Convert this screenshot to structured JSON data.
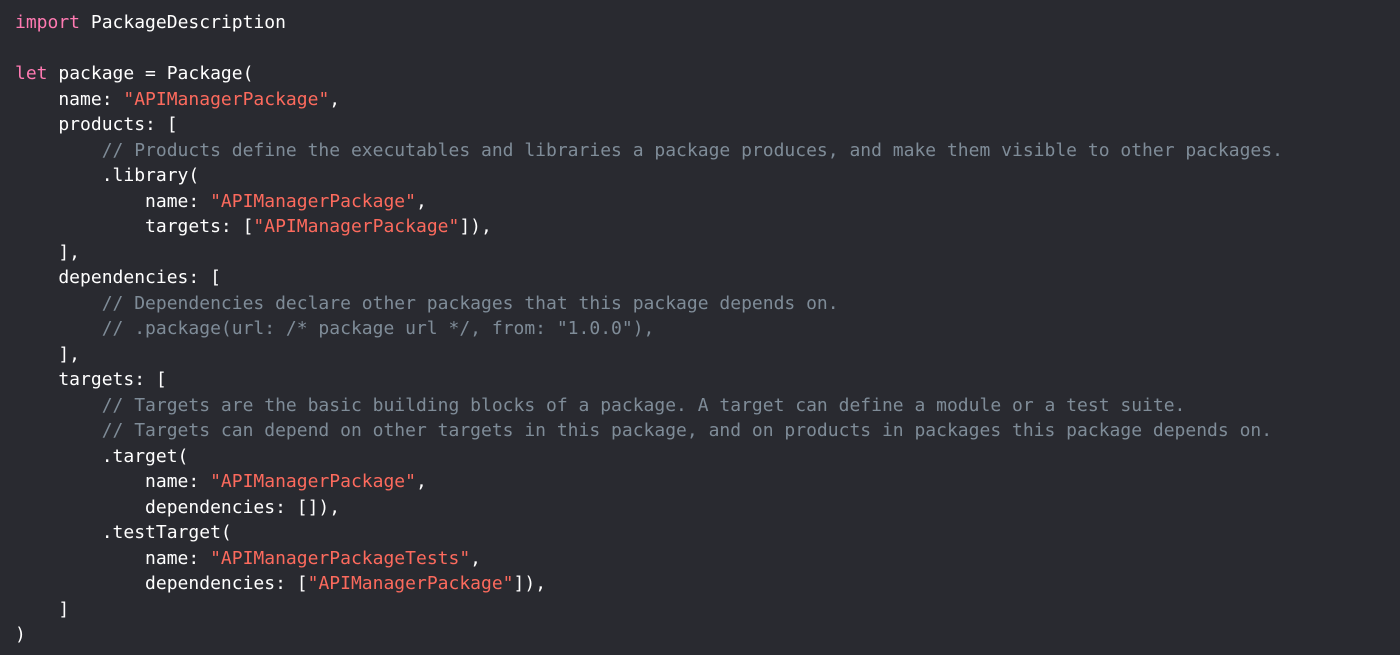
{
  "editor": {
    "language": "swift",
    "colors": {
      "background": "#292a30",
      "plain": "#ffffff",
      "keyword": "#ff7ab2",
      "string": "#fc6a5d",
      "comment": "#7f8c98"
    },
    "lines": [
      [
        {
          "t": "keyword",
          "v": "import"
        },
        {
          "t": "plain",
          "v": " PackageDescription"
        }
      ],
      [],
      [
        {
          "t": "keyword",
          "v": "let"
        },
        {
          "t": "plain",
          "v": " package = Package("
        }
      ],
      [
        {
          "t": "plain",
          "v": "    name: "
        },
        {
          "t": "string",
          "v": "\"APIManagerPackage\""
        },
        {
          "t": "plain",
          "v": ","
        }
      ],
      [
        {
          "t": "plain",
          "v": "    products: ["
        }
      ],
      [
        {
          "t": "comment",
          "v": "        // Products define the executables and libraries a package produces, and make them visible to other packages."
        }
      ],
      [
        {
          "t": "plain",
          "v": "        .library("
        }
      ],
      [
        {
          "t": "plain",
          "v": "            name: "
        },
        {
          "t": "string",
          "v": "\"APIManagerPackage\""
        },
        {
          "t": "plain",
          "v": ","
        }
      ],
      [
        {
          "t": "plain",
          "v": "            targets: ["
        },
        {
          "t": "string",
          "v": "\"APIManagerPackage\""
        },
        {
          "t": "plain",
          "v": "]),"
        }
      ],
      [
        {
          "t": "plain",
          "v": "    ],"
        }
      ],
      [
        {
          "t": "plain",
          "v": "    dependencies: ["
        }
      ],
      [
        {
          "t": "comment",
          "v": "        // Dependencies declare other packages that this package depends on."
        }
      ],
      [
        {
          "t": "comment",
          "v": "        // .package(url: /* package url */, from: \"1.0.0\"),"
        }
      ],
      [
        {
          "t": "plain",
          "v": "    ],"
        }
      ],
      [
        {
          "t": "plain",
          "v": "    targets: ["
        }
      ],
      [
        {
          "t": "comment",
          "v": "        // Targets are the basic building blocks of a package. A target can define a module or a test suite."
        }
      ],
      [
        {
          "t": "comment",
          "v": "        // Targets can depend on other targets in this package, and on products in packages this package depends on."
        }
      ],
      [
        {
          "t": "plain",
          "v": "        .target("
        }
      ],
      [
        {
          "t": "plain",
          "v": "            name: "
        },
        {
          "t": "string",
          "v": "\"APIManagerPackage\""
        },
        {
          "t": "plain",
          "v": ","
        }
      ],
      [
        {
          "t": "plain",
          "v": "            dependencies: []),"
        }
      ],
      [
        {
          "t": "plain",
          "v": "        .testTarget("
        }
      ],
      [
        {
          "t": "plain",
          "v": "            name: "
        },
        {
          "t": "string",
          "v": "\"APIManagerPackageTests\""
        },
        {
          "t": "plain",
          "v": ","
        }
      ],
      [
        {
          "t": "plain",
          "v": "            dependencies: ["
        },
        {
          "t": "string",
          "v": "\"APIManagerPackage\""
        },
        {
          "t": "plain",
          "v": "]),"
        }
      ],
      [
        {
          "t": "plain",
          "v": "    ]"
        }
      ],
      [
        {
          "t": "plain",
          "v": ")"
        }
      ]
    ]
  }
}
